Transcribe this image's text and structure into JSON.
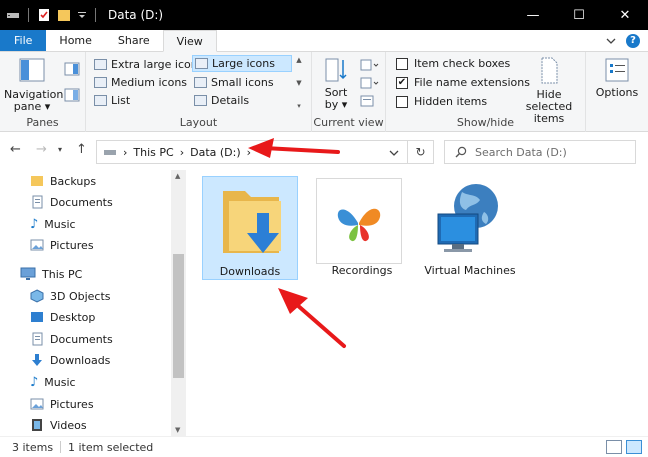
{
  "window": {
    "title": "Data (D:)",
    "minimize_glyph": "—",
    "maximize_glyph": "☐",
    "close_glyph": "✕"
  },
  "ribbon_tabs": {
    "file": "File",
    "home": "Home",
    "share": "Share",
    "view": "View"
  },
  "ribbon": {
    "panes": {
      "label": "Panes",
      "navigation_pane": "Navigation pane ▾"
    },
    "layout": {
      "label": "Layout",
      "items": [
        "Extra large icons",
        "Large icons",
        "Medium icons",
        "Small icons",
        "List",
        "Details"
      ],
      "selected": "Large icons"
    },
    "current_view": {
      "label": "Current view",
      "sort_by": "Sort by ▾"
    },
    "show_hide": {
      "label": "Show/hide",
      "item_check_boxes": "Item check boxes",
      "file_name_extensions": "File name extensions",
      "hidden_items": "Hidden items",
      "hide_selected_items": "Hide selected items",
      "item_check_boxes_checked": false,
      "file_name_extensions_checked": true,
      "hidden_items_checked": false
    },
    "options": {
      "label": "Options"
    }
  },
  "address": {
    "segments": [
      "This PC",
      "Data (D:)"
    ],
    "search_placeholder": "Search Data (D:)"
  },
  "nav_pane": {
    "quick_items": [
      "Backups",
      "Documents",
      "Music",
      "Pictures"
    ],
    "this_pc": "This PC",
    "pc_items": [
      "3D Objects",
      "Desktop",
      "Documents",
      "Downloads",
      "Music",
      "Pictures",
      "Videos"
    ]
  },
  "content": {
    "items": [
      {
        "name": "Downloads",
        "selected": true
      },
      {
        "name": "Recordings",
        "selected": false
      },
      {
        "name": "Virtual Machines",
        "selected": false
      }
    ]
  },
  "status": {
    "item_count": "3 items",
    "selection": "1 item selected"
  },
  "colors": {
    "accent": "#1979ca",
    "selection_bg": "#cce8ff",
    "selection_border": "#99d1ff",
    "annotation_arrow": "#e8191a"
  }
}
